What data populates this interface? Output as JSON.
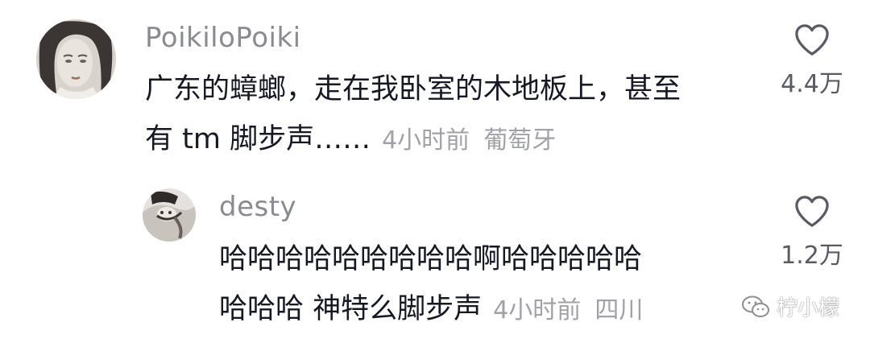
{
  "comment": {
    "username": "PoikiloPoiki",
    "text_line1": "广东的蟑螂，走在我卧室的木地板上，甚至",
    "text_line2": "有 tm 脚步声……",
    "time": "4小时前",
    "location": "葡萄牙",
    "like_count": "4.4万",
    "avatar_icon": "avatar-portrait-icon",
    "like_icon": "heart-outline-icon"
  },
  "reply": {
    "username": "desty",
    "text_line1": "哈哈哈哈哈哈哈哈哈啊哈哈哈哈哈",
    "text_line2": "哈哈哈 神特么脚步声",
    "time": "4小时前",
    "location": "四川",
    "like_count": "1.2万",
    "avatar_icon": "avatar-photo-icon",
    "like_icon": "heart-outline-icon"
  },
  "watermark": {
    "text": "柠小檬",
    "icon": "wechat-icon"
  },
  "colors": {
    "text": "#161823",
    "username": "#8a8b91",
    "meta": "#a1a2a7",
    "like_count": "#5a5b62"
  }
}
